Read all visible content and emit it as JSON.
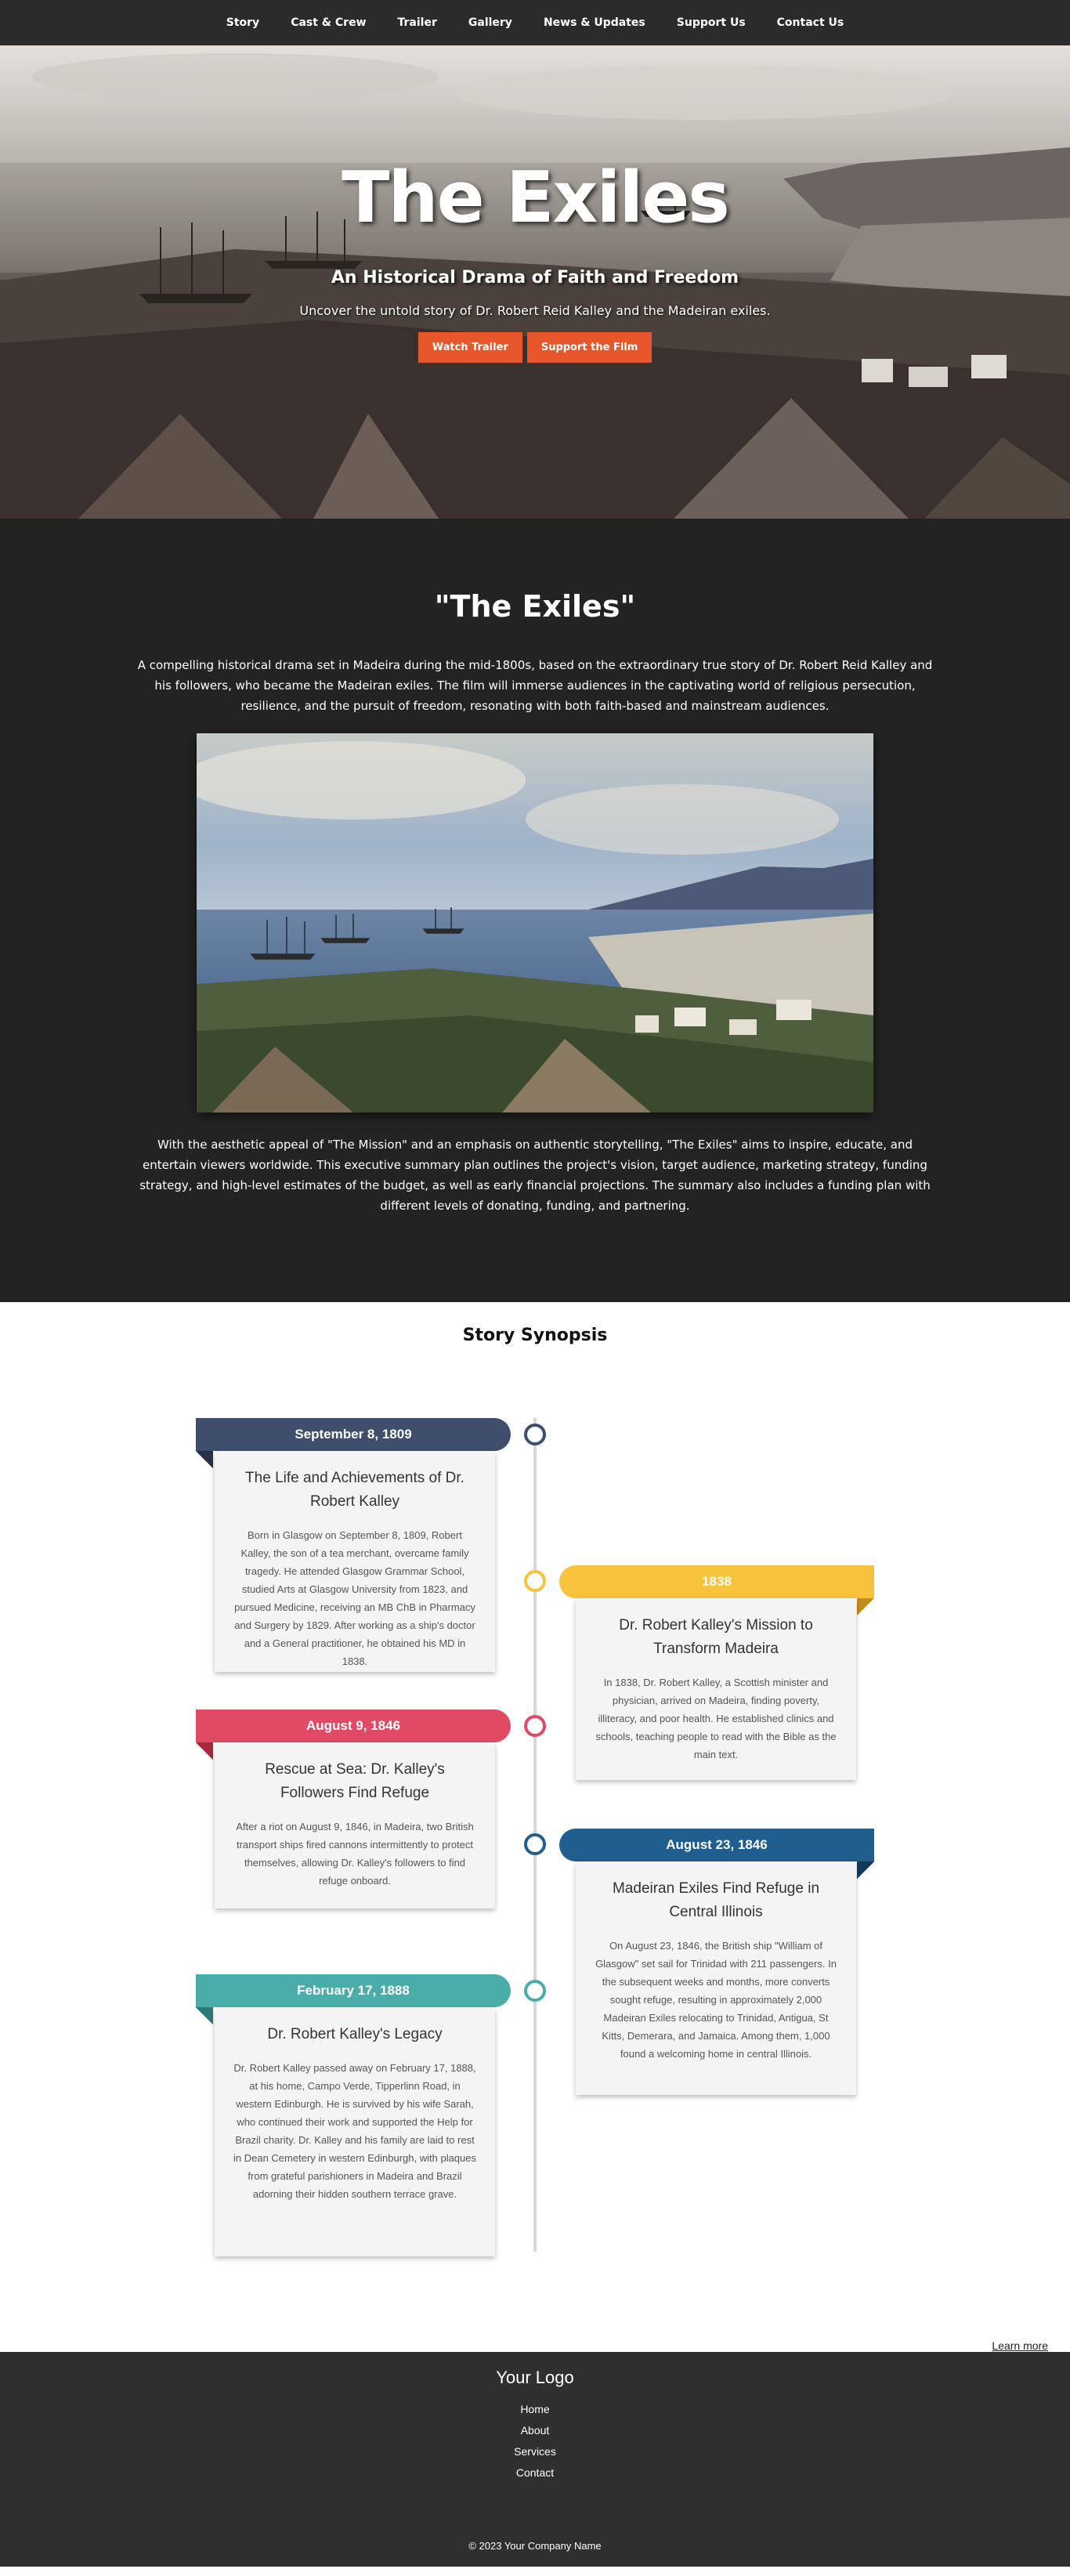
{
  "nav": {
    "items": [
      "Story",
      "Cast & Crew",
      "Trailer",
      "Gallery",
      "News & Updates",
      "Support Us",
      "Contact Us"
    ]
  },
  "hero": {
    "title": "The Exiles",
    "subtitle": "An Historical Drama of Faith and Freedom",
    "description": "Uncover the untold story of Dr. Robert Reid Kalley and the Madeiran exiles.",
    "buttons": {
      "watch": "Watch Trailer",
      "support": "Support the Film"
    }
  },
  "about": {
    "title": "\"The Exiles\"",
    "lead": "A compelling historical drama set in Madeira during the mid-1800s, based on the extraordinary true story of Dr. Robert Reid Kalley and his followers, who became the Madeiran exiles. The film will immerse audiences in the captivating world of religious persecution, resilience, and the pursuit of freedom, resonating with both faith-based and mainstream audiences.",
    "body": "With the aesthetic appeal of \"The Mission\" and an emphasis on authentic storytelling, \"The Exiles\" aims to inspire, educate, and entertain viewers worldwide. This executive summary plan outlines the project's vision, target audience, marketing strategy, funding strategy, and high-level estimates of the budget, as well as early financial projections. The summary also includes a funding plan with different levels of donating, funding, and partnering."
  },
  "synopsis": {
    "title": "Story Synopsis",
    "events": [
      {
        "date": "September 8, 1809",
        "title": "The Life and Achievements of Dr. Robert Kalley",
        "text": "Born in Glasgow on September 8, 1809, Robert Kalley, the son of a tea merchant, overcame family tragedy. He attended Glasgow Grammar School, studied Arts at Glasgow University from 1823, and pursued Medicine, receiving an MB ChB in Pharmacy and Surgery by 1829. After working as a ship's doctor and a General practitioner, he obtained his MD in 1838.",
        "color": "#3e4e6b",
        "fold": "#26324a"
      },
      {
        "date": "1838",
        "title": "Dr. Robert Kalley's Mission to Transform Madeira",
        "text": "In 1838, Dr. Robert Kalley, a Scottish minister and physician, arrived on Madeira, finding poverty, illiteracy, and poor health. He established clinics and schools, teaching people to read with the Bible as the main text.",
        "color": "#f7c33c",
        "fold": "#c48c1c"
      },
      {
        "date": "August 9, 1846",
        "title": "Rescue at Sea: Dr. Kalley's Followers Find Refuge",
        "text": "After a riot on August 9, 1846, in Madeira, two British transport ships fired cannons intermittently to protect themselves, allowing Dr. Kalley's followers to find refuge onboard.",
        "color": "#e14a64",
        "fold": "#a5283d"
      },
      {
        "date": "August 23, 1846",
        "title": "Madeiran Exiles Find Refuge in Central Illinois",
        "text": "On August 23, 1846, the British ship \"William of Glasgow\" set sail for Trinidad with 211 passengers. In the subsequent weeks and months, more converts sought refuge, resulting in approximately 2,000 Madeiran Exiles relocating to Trinidad, Antigua, St Kitts, Demerara, and Jamaica. Among them, 1,000 found a welcoming home in central Illinois.",
        "color": "#1f5e8f",
        "fold": "#12395a"
      },
      {
        "date": "February 17, 1888",
        "title": "Dr. Robert Kalley's Legacy",
        "text": "Dr. Robert Kalley passed away on February 17, 1888, at his home, Campo Verde, Tipperlinn Road, in western Edinburgh. He is survived by his wife Sarah, who continued their work and supported the Help for Brazil charity. Dr. Kalley and his family are laid to rest in Dean Cemetery in western Edinburgh, with plaques from grateful parishioners in Madeira and Brazil adorning their hidden southern terrace grave.",
        "color": "#4aadaa",
        "fold": "#2c7a78"
      }
    ],
    "learn_more": "Learn more"
  },
  "footer": {
    "logo": "Your Logo",
    "links": [
      "Home",
      "About",
      "Services",
      "Contact"
    ],
    "copyright": "© 2023 Your Company Name"
  }
}
